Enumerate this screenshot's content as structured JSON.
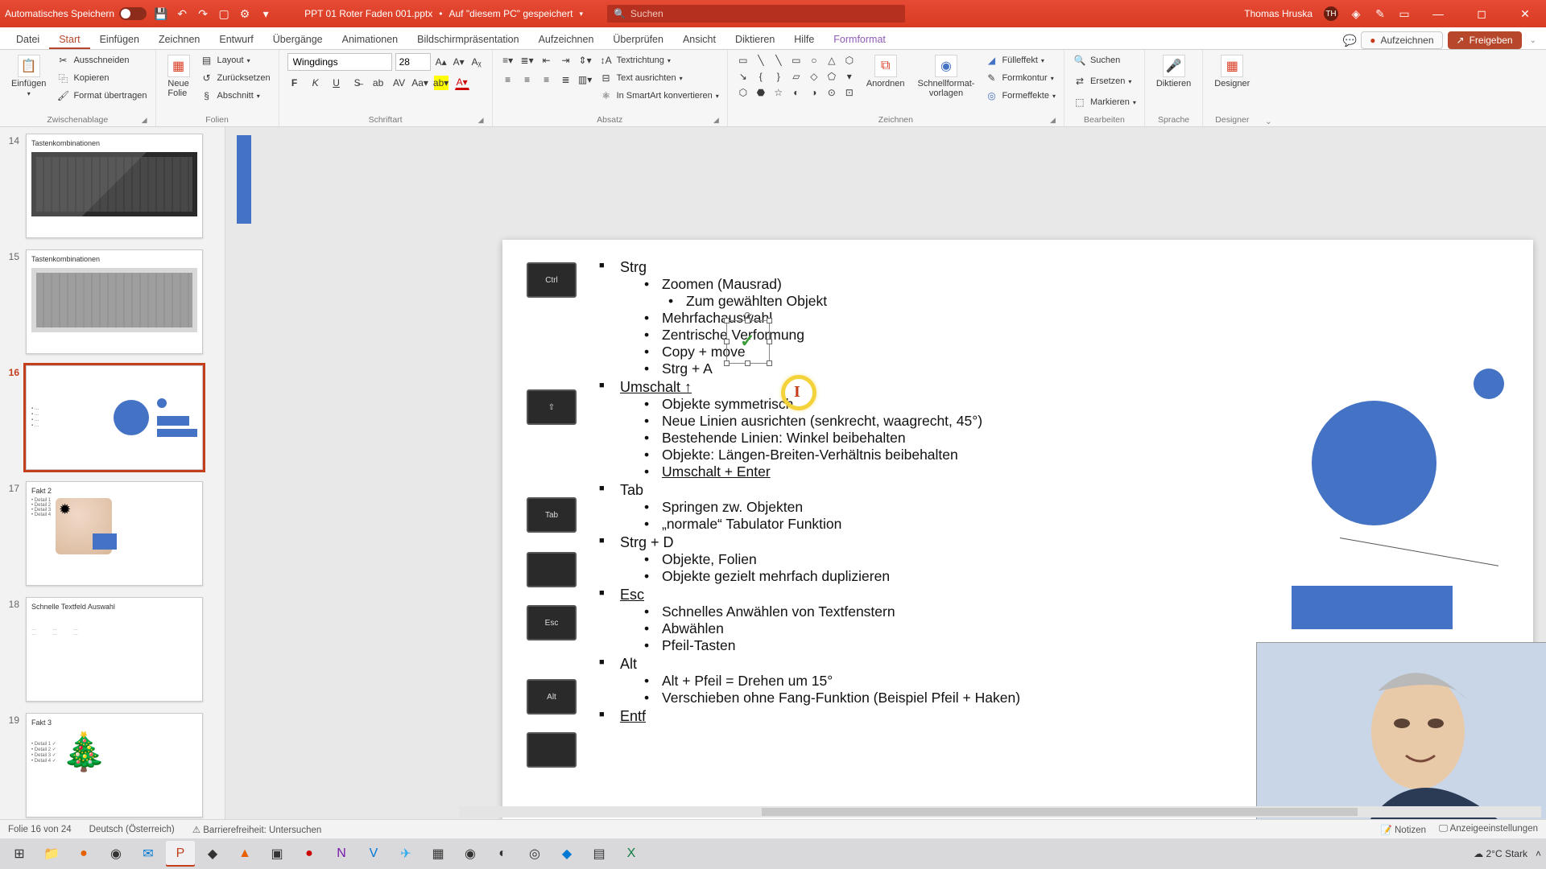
{
  "titlebar": {
    "autosave": "Automatisches Speichern",
    "filename": "PPT 01 Roter Faden 001.pptx",
    "saved_hint": "Auf \"diesem PC\" gespeichert",
    "search_placeholder": "Suchen",
    "user_name": "Thomas Hruska",
    "user_initials": "TH"
  },
  "tabs": {
    "items": [
      "Datei",
      "Start",
      "Einfügen",
      "Zeichnen",
      "Entwurf",
      "Übergänge",
      "Animationen",
      "Bildschirmpräsentation",
      "Aufzeichnen",
      "Überprüfen",
      "Ansicht",
      "Diktieren",
      "Hilfe",
      "Formformat"
    ],
    "active_index": 1,
    "record": "Aufzeichnen",
    "share": "Freigeben"
  },
  "ribbon": {
    "clipboard": {
      "label": "Zwischenablage",
      "paste": "Einfügen",
      "cut": "Ausschneiden",
      "copy": "Kopieren",
      "format_painter": "Format übertragen"
    },
    "slides": {
      "label": "Folien",
      "new": "Neue\nFolie",
      "layout": "Layout",
      "reset": "Zurücksetzen",
      "section": "Abschnitt"
    },
    "font": {
      "label": "Schriftart",
      "name": "Wingdings",
      "size": "28"
    },
    "paragraph": {
      "label": "Absatz",
      "text_dir": "Textrichtung",
      "align": "Text ausrichten",
      "smartart": "In SmartArt konvertieren"
    },
    "drawing": {
      "label": "Zeichnen",
      "arrange": "Anordnen",
      "quick": "Schnellformat-\nvorlagen",
      "fill": "Fülleffekt",
      "outline": "Formkontur",
      "effects": "Formeffekte"
    },
    "editing": {
      "label": "Bearbeiten",
      "find": "Suchen",
      "replace": "Ersetzen",
      "select": "Markieren"
    },
    "voice": {
      "label": "Sprache",
      "dictate": "Diktieren"
    },
    "designer": {
      "label": "Designer",
      "btn": "Designer"
    }
  },
  "thumbs": [
    {
      "num": "14",
      "title": "Tastenkombinationen",
      "kind": "kb-dark"
    },
    {
      "num": "15",
      "title": "Tastenkombinationen",
      "kind": "kb-light"
    },
    {
      "num": "16",
      "title": "",
      "kind": "current"
    },
    {
      "num": "17",
      "title": "Fakt 2",
      "kind": "fact2"
    },
    {
      "num": "18",
      "title": "Schnelle Textfeld Auswahl",
      "kind": "textfields"
    },
    {
      "num": "19",
      "title": "Fakt 3",
      "kind": "fact3"
    }
  ],
  "slide": {
    "keys": [
      "Ctrl",
      "⇧",
      "Tab",
      "",
      "Esc",
      "Alt",
      ""
    ],
    "strg": {
      "head": "Strg",
      "items": [
        "Zoomen (Mausrad)",
        "Mehrfachauswahl",
        "Zentrische Verformung",
        "Copy + move",
        "Strg + A"
      ],
      "sub": "Zum gewählten Objekt"
    },
    "umschalt": {
      "head": "Umschalt ↑",
      "items": [
        "Objekte symmetrisch",
        "Neue Linien ausrichten (senkrecht, waagrecht, 45°)",
        "Bestehende Linien: Winkel beibehalten",
        "Objekte: Längen-Breiten-Verhältnis beibehalten",
        "Umschalt + Enter"
      ]
    },
    "tab": {
      "head": "Tab",
      "items": [
        "Springen zw. Objekten",
        "„normale“ Tabulator Funktion"
      ]
    },
    "strgd": {
      "head": "Strg + D",
      "items": [
        "Objekte, Folien",
        "Objekte gezielt mehrfach duplizieren"
      ]
    },
    "esc": {
      "head": "Esc",
      "items": [
        "Schnelles Anwählen von Textfenstern",
        "Abwählen",
        "Pfeil-Tasten"
      ]
    },
    "alt": {
      "head": "Alt",
      "items": [
        "Alt + Pfeil = Drehen um 15°",
        "Verschieben ohne Fang-Funktion (Beispiel Pfeil + Haken)"
      ]
    },
    "entf": {
      "head": "Entf"
    },
    "checkmark": "✓"
  },
  "status": {
    "slide": "Folie 16 von 24",
    "lang": "Deutsch (Österreich)",
    "access": "Barrierefreiheit: Untersuchen",
    "notes": "Notizen",
    "display": "Anzeigeeinstellungen"
  },
  "taskbar": {
    "weather_temp": "2°C",
    "weather_text": "Stark"
  },
  "colors": {
    "accent": "#c43e1c",
    "blue": "#4472c4"
  }
}
